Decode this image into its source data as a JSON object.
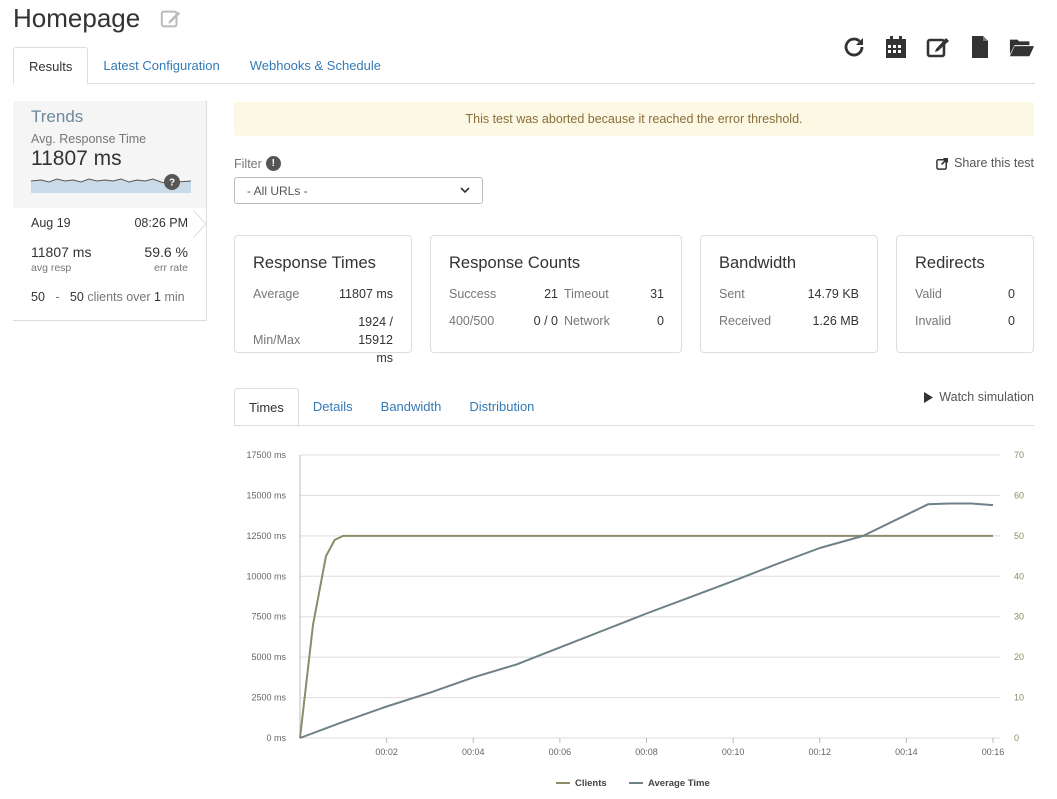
{
  "page": {
    "title": "Homepage"
  },
  "toolbar": {
    "icons": [
      "refresh-icon",
      "calendar-icon",
      "edit-icon",
      "document-icon",
      "folder-open-icon"
    ]
  },
  "tabs": [
    {
      "label": "Results",
      "active": true
    },
    {
      "label": "Latest Configuration",
      "active": false
    },
    {
      "label": "Webhooks & Schedule",
      "active": false
    }
  ],
  "sidebar": {
    "trends": "Trends",
    "metric_label": "Avg. Response Time",
    "metric_value": "11807 ms",
    "spark_badge": "?",
    "date": "Aug 19",
    "time": "08:26 PM",
    "avg_resp_value": "11807 ms",
    "avg_resp_label": "avg resp",
    "err_rate_value": "59.6 %",
    "err_rate_label": "err rate",
    "clients_from": "50",
    "clients_sep": "-",
    "clients_to": "50",
    "clients_mid": "clients over",
    "clients_duration": "1",
    "clients_unit": "min"
  },
  "alert": {
    "text": "This test was aborted because it reached the error threshold."
  },
  "filter": {
    "label": "Filter",
    "info": "!",
    "selected": "- All URLs -"
  },
  "share": {
    "label": "Share this test"
  },
  "cards": {
    "response_times": {
      "title": "Response Times",
      "average_label": "Average",
      "average_value": "11807 ms",
      "minmax_label": "Min/Max",
      "minmax_value_line1": "1924 / 15912",
      "minmax_value_line2": "ms"
    },
    "response_counts": {
      "title": "Response Counts",
      "success_label": "Success",
      "success_value": "21",
      "timeout_label": "Timeout",
      "timeout_value": "31",
      "http_err_label": "400/500",
      "http_err_value": "0 / 0",
      "network_label": "Network",
      "network_value": "0"
    },
    "bandwidth": {
      "title": "Bandwidth",
      "sent_label": "Sent",
      "sent_value": "14.79 KB",
      "received_label": "Received",
      "received_value": "1.26 MB"
    },
    "redirects": {
      "title": "Redirects",
      "valid_label": "Valid",
      "valid_value": "0",
      "invalid_label": "Invalid",
      "invalid_value": "0"
    }
  },
  "subtabs": [
    {
      "label": "Times",
      "active": true
    },
    {
      "label": "Details",
      "active": false
    },
    {
      "label": "Bandwidth",
      "active": false
    },
    {
      "label": "Distribution",
      "active": false
    }
  ],
  "watch": {
    "label": "Watch simulation"
  },
  "colors": {
    "clients_line": "#8e8a6a",
    "avg_time_line": "#6f8188",
    "grid": "#dddddd",
    "link": "#337ab7"
  },
  "chart_data": {
    "type": "line",
    "x_ticks": [
      "00:02",
      "00:04",
      "00:06",
      "00:08",
      "00:10",
      "00:12",
      "00:14",
      "00:16"
    ],
    "y_left_ticks": [
      "0 ms",
      "2500 ms",
      "5000 ms",
      "7500 ms",
      "10000 ms",
      "12500 ms",
      "15000 ms",
      "17500 ms"
    ],
    "y_right_ticks": [
      "0",
      "10",
      "20",
      "30",
      "40",
      "50",
      "60",
      "70"
    ],
    "ylim_left": [
      0,
      17500
    ],
    "ylim_right": [
      0,
      70
    ],
    "xlim_seconds": [
      0,
      16
    ],
    "grid": true,
    "legend_position": "bottom",
    "series": [
      {
        "name": "Clients",
        "axis": "right",
        "x_seconds": [
          0,
          0.3,
          0.6,
          0.8,
          1.0,
          16
        ],
        "values": [
          0,
          28,
          45,
          49,
          50,
          50
        ]
      },
      {
        "name": "Average Time",
        "axis": "left",
        "x_seconds": [
          0,
          1,
          2,
          3,
          4,
          5,
          6,
          7,
          8,
          9,
          10,
          11,
          12,
          13,
          14,
          14.5,
          15,
          15.5,
          16
        ],
        "values": [
          0,
          1000,
          1950,
          2800,
          3750,
          4550,
          5600,
          6650,
          7700,
          8700,
          9700,
          10750,
          11750,
          12500,
          13800,
          14450,
          14500,
          14500,
          14400
        ]
      }
    ]
  }
}
